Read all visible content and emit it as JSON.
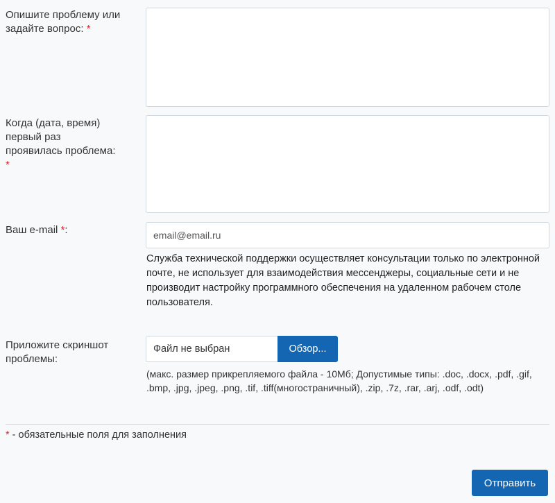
{
  "form": {
    "question": {
      "label": "Опишите проблему или задайте вопрос:",
      "required_mark": "*"
    },
    "when": {
      "label": "Когда (дата, время) первый раз проявилась проблема:",
      "required_mark": "*"
    },
    "email": {
      "label": "Ваш e-mail",
      "required_mark": "*",
      "label_suffix": ":",
      "placeholder": "email@email.ru",
      "note": "Служба технической поддержки осуществляет консультации только по электронной почте, не использует для взаимодействия мессенджеры, социальные сети и не производит настройку программного обеспечения на удаленном рабочем столе пользователя."
    },
    "screenshot": {
      "label": "Приложите скриншот проблемы:",
      "file_status": "Файл не выбран",
      "browse_label": "Обзор...",
      "hint": "(макс. размер прикрепляемого файла - 10Мб; Допустимые типы: .doc, .docx, .pdf, .gif, .bmp, .jpg, .jpeg, .png, .tif, .tiff(многостраничный), .zip, .7z, .rar, .arj, .odf, .odt)"
    },
    "footnote": {
      "mark": "*",
      "text": " - обязательные поля для заполнения"
    },
    "submit_label": "Отправить"
  },
  "colors": {
    "background": "#f8f9fa",
    "accent": "#1466b3",
    "required": "#d9232e",
    "field_border": "#cfd8e1"
  }
}
